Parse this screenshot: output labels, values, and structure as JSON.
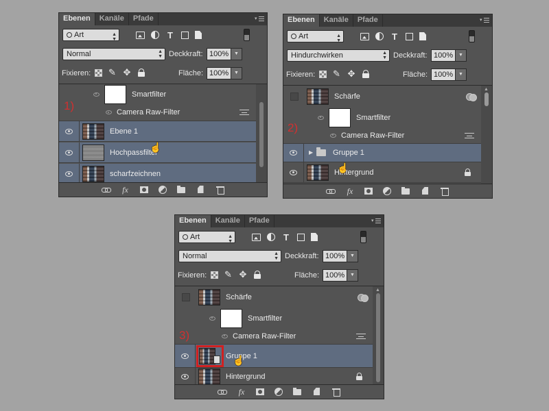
{
  "tabs": [
    "Ebenen",
    "Kanäle",
    "Pfade"
  ],
  "filter": {
    "kind_label": "Art"
  },
  "labels": {
    "opacity": "Deckkraft:",
    "lock": "Fixieren:",
    "fill": "Fläche:"
  },
  "icons": {
    "filter": [
      "image-filter-icon",
      "adjustment-filter-icon",
      "type-filter-icon",
      "shape-filter-icon",
      "smart-object-filter-icon"
    ],
    "lock": [
      "lock-transparent-icon",
      "lock-image-icon",
      "lock-position-icon",
      "lock-all-icon"
    ],
    "footer": [
      "link-layers-icon",
      "fx-icon",
      "add-mask-icon",
      "new-adjustment-icon",
      "new-group-icon",
      "new-layer-icon",
      "trash-icon"
    ]
  },
  "colors": {
    "selection": "#5f6c80",
    "step_label": "#d03030",
    "panel_bg": "#535353"
  },
  "panels": [
    {
      "step": "1)",
      "blend_mode": "Normal",
      "opacity": "100%",
      "fill": "100%",
      "layers": [
        {
          "type": "smartfilter-mask",
          "name": "Smartfilter"
        },
        {
          "type": "filter",
          "name": "Camera Raw-Filter"
        },
        {
          "type": "layer",
          "name": "Ebene 1",
          "selected": true
        },
        {
          "type": "layer",
          "name": "Hochpassfilter",
          "selected": true
        },
        {
          "type": "layer",
          "name": "scharfzeichnen",
          "selected": true
        }
      ]
    },
    {
      "step": "2)",
      "blend_mode": "Hindurchwirken",
      "opacity": "100%",
      "fill": "100%",
      "layers": [
        {
          "type": "smart-object",
          "name": "Schärfe",
          "visible": false
        },
        {
          "type": "smartfilter-mask",
          "name": "Smartfilter"
        },
        {
          "type": "filter",
          "name": "Camera Raw-Filter"
        },
        {
          "type": "group",
          "name": "Gruppe 1",
          "selected": true
        },
        {
          "type": "background",
          "name": "Hintergrund",
          "locked": true
        }
      ]
    },
    {
      "step": "3)",
      "blend_mode": "Normal",
      "opacity": "100%",
      "fill": "100%",
      "layers": [
        {
          "type": "smart-object",
          "name": "Schärfe",
          "visible": false
        },
        {
          "type": "smartfilter-mask",
          "name": "Smartfilter"
        },
        {
          "type": "filter",
          "name": "Camera Raw-Filter"
        },
        {
          "type": "smart-object",
          "name": "Gruppe 1",
          "selected": true,
          "highlighted": true
        },
        {
          "type": "background",
          "name": "Hintergrund",
          "locked": true
        }
      ]
    }
  ]
}
